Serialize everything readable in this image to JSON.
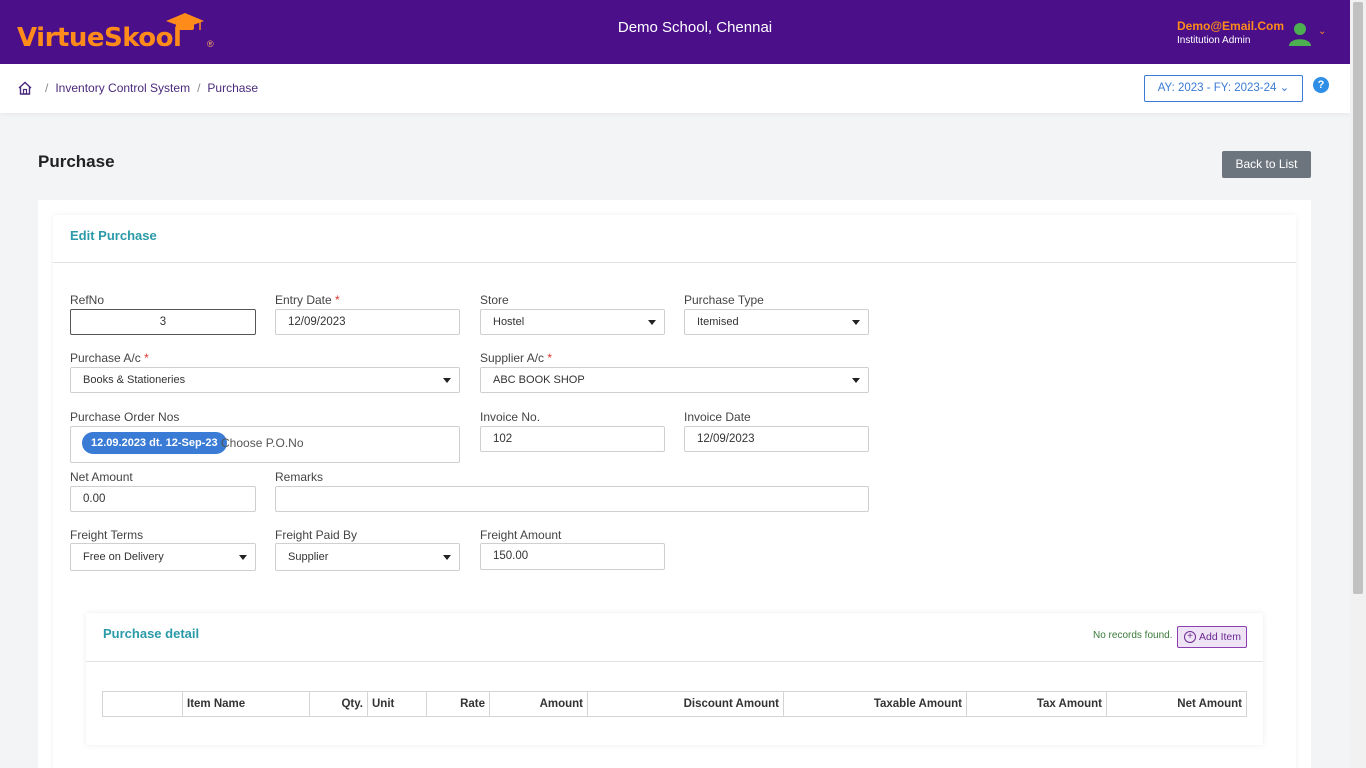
{
  "header": {
    "logo_text": "VirtueSkool",
    "school_name": "Demo School, Chennai",
    "user_email": "Demo@Email.Com",
    "user_role": "Institution Admin"
  },
  "breadcrumb": {
    "items": [
      "Inventory Control System",
      "Purchase"
    ]
  },
  "academic_year": "AY: 2023 - FY: 2023-24",
  "page": {
    "title": "Purchase",
    "back_label": "Back to List",
    "card_title": "Edit Purchase"
  },
  "form": {
    "refno": {
      "label": "RefNo",
      "value": "3"
    },
    "entry_date": {
      "label": "Entry Date",
      "value": "12/09/2023"
    },
    "store": {
      "label": "Store",
      "value": "Hostel"
    },
    "purchase_type": {
      "label": "Purchase Type",
      "value": "Itemised"
    },
    "purchase_ac": {
      "label": "Purchase A/c",
      "value": "Books & Stationeries"
    },
    "supplier_ac": {
      "label": "Supplier A/c",
      "value": "ABC BOOK SHOP"
    },
    "po_nos": {
      "label": "Purchase Order Nos",
      "chip": "12.09.2023 dt. 12-Sep-23",
      "placeholder": "Choose P.O.No"
    },
    "invoice_no": {
      "label": "Invoice No.",
      "value": "102"
    },
    "invoice_date": {
      "label": "Invoice Date",
      "value": "12/09/2023"
    },
    "net_amount": {
      "label": "Net Amount",
      "value": "0.00"
    },
    "remarks": {
      "label": "Remarks",
      "value": ""
    },
    "freight_terms": {
      "label": "Freight Terms",
      "value": "Free on Delivery"
    },
    "freight_paid_by": {
      "label": "Freight Paid By",
      "value": "Supplier"
    },
    "freight_amount": {
      "label": "Freight Amount",
      "value": "150.00"
    }
  },
  "detail": {
    "title": "Purchase detail",
    "no_records": "No records found.",
    "add_label": "Add Item",
    "columns": [
      "",
      "Item Name",
      "Qty.",
      "Unit",
      "Rate",
      "Amount",
      "Discount Amount",
      "Taxable Amount",
      "Tax Amount",
      "Net Amount"
    ]
  },
  "colors": {
    "header_bg": "#4b0f8a",
    "accent_orange": "#ff8c1a",
    "section_title": "#2a9aa8",
    "primary_blue": "#3a7bd5"
  }
}
